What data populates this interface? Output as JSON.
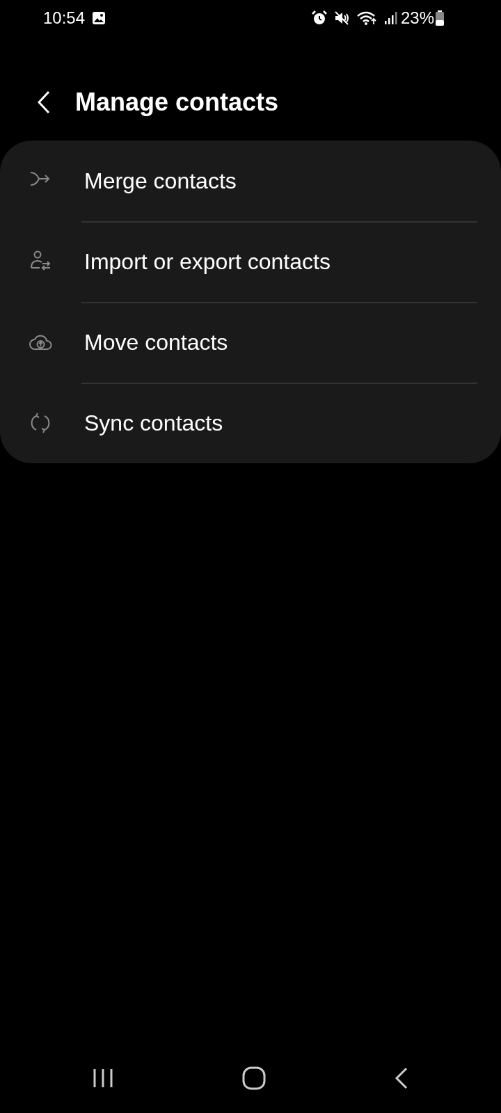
{
  "status_bar": {
    "time": "10:54",
    "battery": "23%"
  },
  "header": {
    "title": "Manage contacts"
  },
  "items": [
    {
      "kind": "merge",
      "label": "Merge contacts"
    },
    {
      "kind": "import-export",
      "label": "Import or export contacts"
    },
    {
      "kind": "move",
      "label": "Move contacts"
    },
    {
      "kind": "sync",
      "label": "Sync contacts"
    }
  ]
}
